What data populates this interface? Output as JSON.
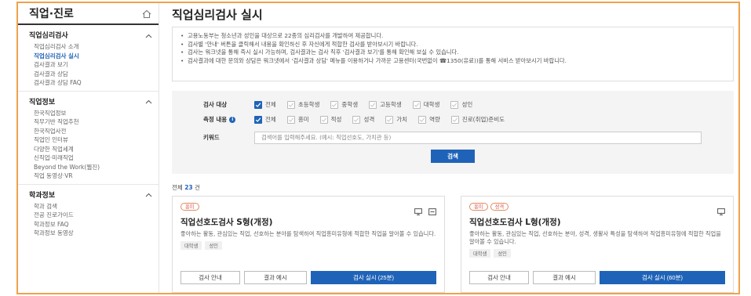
{
  "sidebar": {
    "title": "직업·진로",
    "sections": [
      {
        "title": "직업심리검사",
        "items": [
          "직업심리검사 소개",
          "직업심리검사 실시",
          "검사결과 보기",
          "검사결과 상담",
          "검사결과 상담 FAQ"
        ],
        "active_index": 1
      },
      {
        "title": "직업정보",
        "items": [
          "한국직업정보",
          "직무기반 직업추천",
          "한국직업사전",
          "직업인 인터뷰",
          "다양한 직업세계",
          "신직업·미래직업",
          "Beyond the Work(웹진)",
          "직업 동영상·VR"
        ]
      },
      {
        "title": "학과정보",
        "items": [
          "학과 검색",
          "전공 진로가이드",
          "학과정보 FAQ",
          "학과정보 동영상"
        ]
      }
    ]
  },
  "page": {
    "title": "직업심리검사 실시",
    "notices": [
      "고용노동부는 청소년과 성인을 대상으로 22종의 심리검사를 개발하여 제공합니다.",
      "검사별 '안내' 버튼을 클릭해서 내용을 확인하신 후 자신에게 적합한 검사를 받아보시기 바랍니다.",
      "검사는 워크넷을 통해 즉시 실시 가능하며, 검사결과는 검사 직후 '검사결과 보기'를 통해 확인해 보실 수 있습니다.",
      "검사결과에 대한 문의와 상담은 워크넷에서 '검사결과 상담' 메뉴를 이용하거나 가까운 고용센터(국번없이 ☎1350(유료))를 통해 서비스 받아보시기 바랍니다."
    ]
  },
  "filter": {
    "target_label": "검사 대상",
    "target_options": [
      {
        "label": "전체",
        "checked": true
      },
      {
        "label": "초등학생",
        "checked": false
      },
      {
        "label": "중학생",
        "checked": false
      },
      {
        "label": "고등학생",
        "checked": false
      },
      {
        "label": "대학생",
        "checked": false
      },
      {
        "label": "성인",
        "checked": false
      }
    ],
    "content_label": "측정 내용",
    "content_options": [
      {
        "label": "전체",
        "checked": true
      },
      {
        "label": "흥미",
        "checked": false
      },
      {
        "label": "적성",
        "checked": false
      },
      {
        "label": "성격",
        "checked": false
      },
      {
        "label": "가치",
        "checked": false
      },
      {
        "label": "역량",
        "checked": false
      },
      {
        "label": "진로(취업)준비도",
        "checked": false
      }
    ],
    "keyword_label": "키워드",
    "keyword_placeholder": "검색어를 입력해주세요. (예시: 직업선호도, 가치관 등)",
    "search_label": "검색"
  },
  "results": {
    "total_prefix": "전체",
    "total_count": "23",
    "total_suffix": "건"
  },
  "cards": [
    {
      "badges": [
        "흥미"
      ],
      "title": "직업선호도검사 S형(개정)",
      "desc": "좋아하는 활동, 관심있는 직업, 선호하는 분야를 탐색하여 직업흥미유형에 적합한 직업을 알아볼 수 있습니다.",
      "tags": [
        "대학생",
        "성인"
      ],
      "icons": [
        "pc-icon",
        "print-icon"
      ],
      "guide_label": "검사 안내",
      "example_label": "결과 예시",
      "start_label": "검사 실시 (25분)"
    },
    {
      "badges": [
        "흥미",
        "성격"
      ],
      "title": "직업선호도검사 L형(개정)",
      "desc": "좋아하는 활동, 관심있는 직업, 선호하는 분야, 성격, 생활사 특성을 탐색하여 직업흥미유형에 적합한 직업을 알아볼 수 있습니다.",
      "tags": [
        "대학생",
        "성인"
      ],
      "icons": [
        "pc-icon"
      ],
      "guide_label": "검사 안내",
      "example_label": "결과 예시",
      "start_label": "검사 실시 (60분)"
    }
  ],
  "colors": {
    "accent": "#1f63b8",
    "frame": "#f0a24a",
    "badge": "#d9534f"
  }
}
